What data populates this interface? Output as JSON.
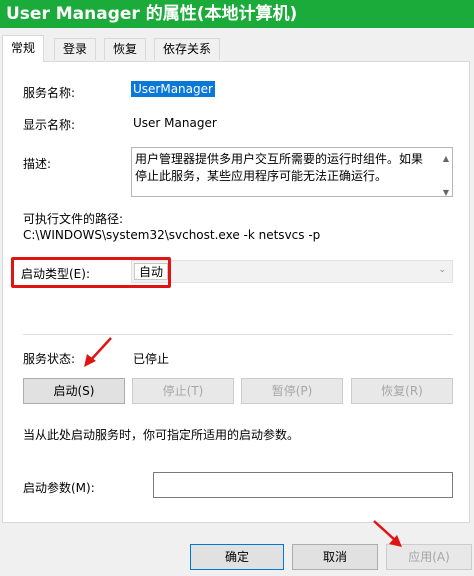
{
  "window": {
    "title": "User Manager 的属性(本地计算机)"
  },
  "tabs": [
    {
      "label": "常规",
      "active": true
    },
    {
      "label": "登录",
      "active": false
    },
    {
      "label": "恢复",
      "active": false
    },
    {
      "label": "依存关系",
      "active": false
    }
  ],
  "general": {
    "service_name_label": "服务名称:",
    "service_name_value": "UserManager",
    "display_name_label": "显示名称:",
    "display_name_value": "User Manager",
    "description_label": "描述:",
    "description_value": "用户管理器提供多用户交互所需要的运行时组件。如果停止此服务，某些应用程序可能无法正确运行。",
    "path_label": "可执行文件的路径:",
    "path_value": "C:\\WINDOWS\\system32\\svchost.exe -k netsvcs -p",
    "startup_type_label": "启动类型(E):",
    "startup_type_value": "自动",
    "status_label": "服务状态:",
    "status_value": "已停止",
    "start_button": "启动(S)",
    "stop_button": "停止(T)",
    "pause_button": "暂停(P)",
    "resume_button": "恢复(R)",
    "hint_text": "当从此处启动服务时，你可指定所适用的启动参数。",
    "start_params_label": "启动参数(M):",
    "start_params_value": ""
  },
  "footer": {
    "ok_button": "确定",
    "cancel_button": "取消",
    "apply_button": "应用(A)"
  },
  "colors": {
    "titlebar": "#1aab3a",
    "annotation": "#e11414",
    "selection": "#0a78d7"
  }
}
